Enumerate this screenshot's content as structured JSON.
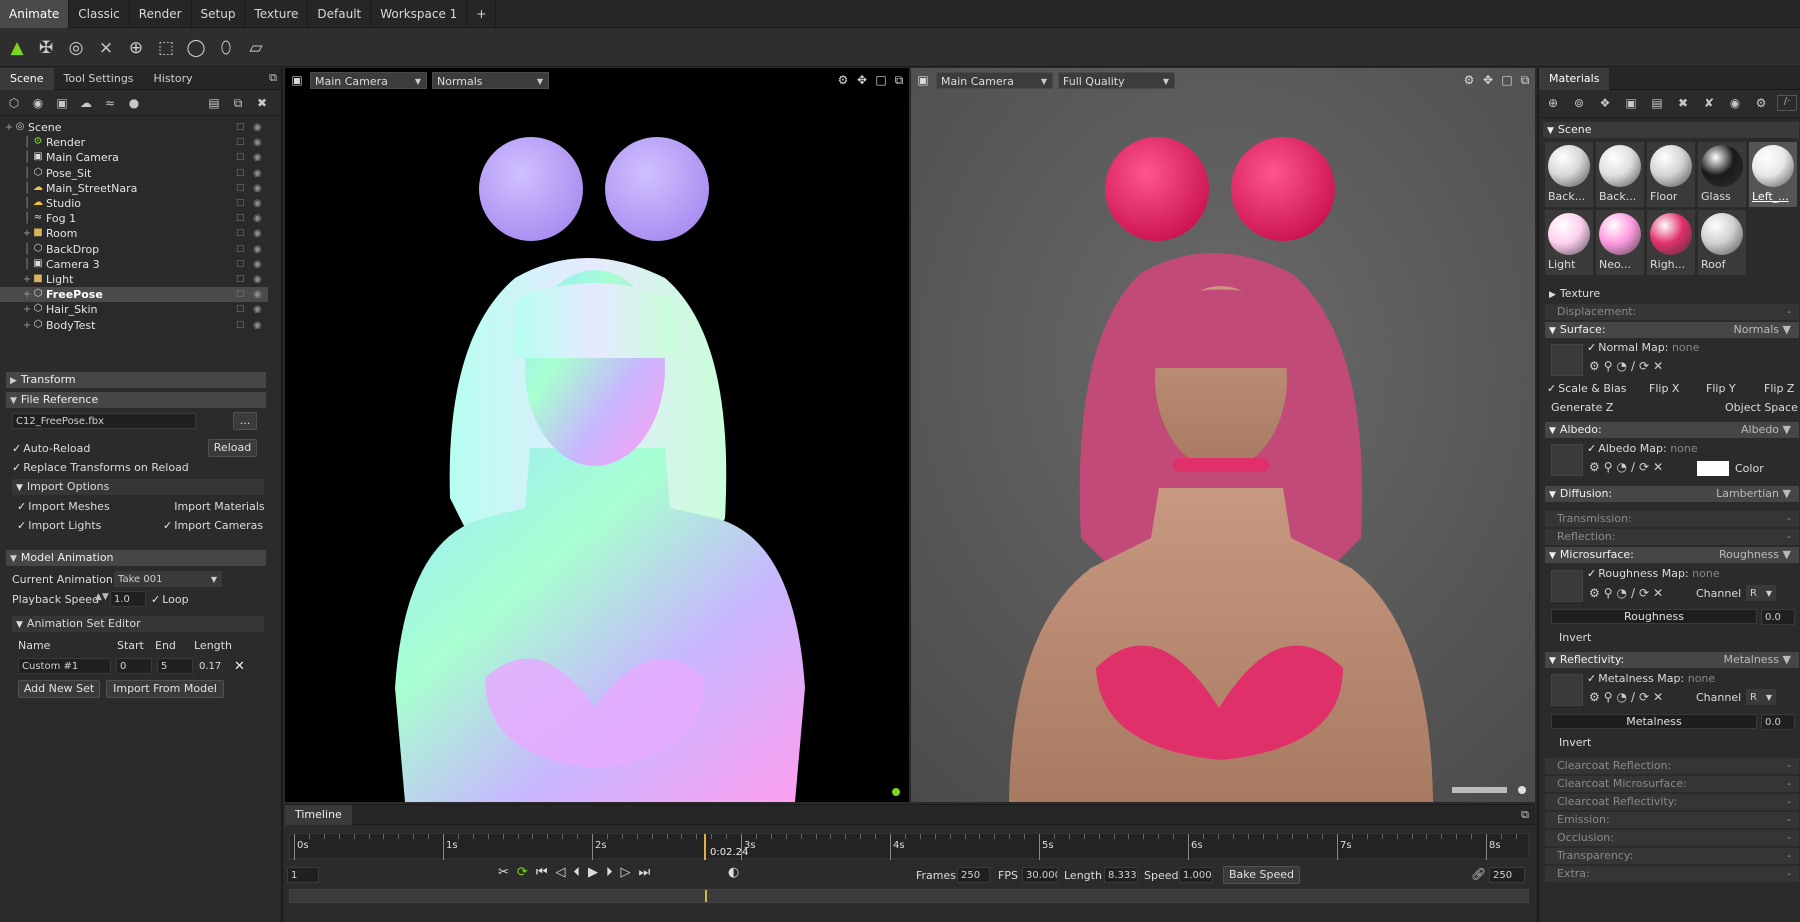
{
  "workspace_tabs": [
    "Animate",
    "Classic",
    "Render",
    "Setup",
    "Texture",
    "Default",
    "Workspace 1",
    "+"
  ],
  "left_tabs": [
    "Scene",
    "Tool Settings",
    "History"
  ],
  "scene_tree": [
    {
      "label": "Scene",
      "icon": "scene-icon"
    },
    {
      "label": "Render",
      "icon": "render-icon"
    },
    {
      "label": "Main Camera",
      "icon": "camera-icon"
    },
    {
      "label": "Pose_Sit",
      "icon": "object-icon"
    },
    {
      "label": "Main_StreetNara",
      "icon": "sky-icon"
    },
    {
      "label": "Studio",
      "icon": "sky-icon"
    },
    {
      "label": "Fog 1",
      "icon": "fog-icon"
    },
    {
      "label": "Room",
      "icon": "folder-icon"
    },
    {
      "label": "BackDrop",
      "icon": "object-icon"
    },
    {
      "label": "Camera 3",
      "icon": "camera-icon"
    },
    {
      "label": "Light",
      "icon": "folder-icon"
    },
    {
      "label": "FreePose",
      "icon": "object-icon"
    },
    {
      "label": "Hair_Skin",
      "icon": "object-icon"
    },
    {
      "label": "BodyTest",
      "icon": "object-icon"
    }
  ],
  "transform_label": "Transform",
  "file_reference": {
    "title": "File Reference",
    "file": "C12_FreePose.fbx",
    "browse": "...",
    "auto_reload": "Auto-Reload",
    "reload": "Reload",
    "replace_transforms": "Replace Transforms on Reload",
    "import_options": "Import Options",
    "import_meshes": "Import Meshes",
    "import_materials": "Import Materials",
    "import_lights": "Import Lights",
    "import_cameras": "Import Cameras"
  },
  "model_animation": {
    "title": "Model Animation",
    "current_label": "Current Animation:",
    "current_value": "Take 001",
    "playback_label": "Playback Speed",
    "playback_value": "1.0",
    "loop": "Loop",
    "set_editor": "Animation Set Editor",
    "col_name": "Name",
    "col_start": "Start",
    "col_end": "End",
    "col_length": "Length",
    "row_name": "Custom #1",
    "row_start": "0",
    "row_end": "5",
    "row_length": "0.17",
    "add_set": "Add New Set",
    "import_from_model": "Import From Model"
  },
  "viewport_left": {
    "camera": "Main Camera",
    "mode": "Normals"
  },
  "viewport_right": {
    "camera": "Main Camera",
    "mode": "Full Quality"
  },
  "timeline": {
    "title": "Timeline",
    "ticks": [
      "0s",
      "1s",
      "2s",
      "3s",
      "4s",
      "5s",
      "6s",
      "7s",
      "8s"
    ],
    "current_time": "0:02.24",
    "current_frame": "1",
    "frames_label": "Frames",
    "frames_value": "250",
    "fps_label": "FPS",
    "fps_value": "30.000",
    "length_label": "Length",
    "length_value": "8.333",
    "speed_label": "Speed",
    "speed_value": "1.000",
    "bake_speed": "Bake Speed",
    "end_frame": "250"
  },
  "materials": {
    "title": "Materials",
    "scene_label": "Scene",
    "items": [
      {
        "name": "Back...",
        "color": "#d8d8d8"
      },
      {
        "name": "Back...",
        "color": "#e0e0e0"
      },
      {
        "name": "Floor",
        "color": "#d4d4d4"
      },
      {
        "name": "Glass",
        "color": "#1a1a1a"
      },
      {
        "name": "Left_...",
        "color": "#e8e8e8"
      },
      {
        "name": "Light",
        "color": "#ffd0f0"
      },
      {
        "name": "Neo...",
        "color": "#ff9ae0"
      },
      {
        "name": "Righ...",
        "color": "#e0306a"
      },
      {
        "name": "Roof",
        "color": "#d0d0d0"
      }
    ],
    "texture": "Texture",
    "displacement": "Displacement:",
    "surface": "Surface:",
    "surface_value": "Normals",
    "normal_map": "Normal Map:",
    "none": "none",
    "scale_bias": "Scale & Bias",
    "flip_x": "Flip X",
    "flip_y": "Flip Y",
    "flip_z": "Flip Z",
    "generate_z": "Generate Z",
    "object_space": "Object Space",
    "albedo": "Albedo:",
    "albedo_value": "Albedo",
    "albedo_map": "Albedo Map:",
    "color": "Color",
    "diffusion": "Diffusion:",
    "diffusion_value": "Lambertian",
    "transmission": "Transmission:",
    "reflection": "Reflection:",
    "microsurface": "Microsurface:",
    "microsurface_value": "Roughness",
    "roughness_map": "Roughness Map:",
    "channel": "Channel",
    "channel_value": "R",
    "roughness": "Roughness",
    "roughness_value": "0.0",
    "invert": "Invert",
    "reflectivity": "Reflectivity:",
    "reflectivity_value": "Metalness",
    "metalness_map": "Metalness Map:",
    "metalness": "Metalness",
    "metalness_value": "0.0",
    "clearcoat_reflection": "Clearcoat Reflection:",
    "clearcoat_microsurface": "Clearcoat Microsurface:",
    "clearcoat_reflectivity": "Clearcoat Reflectivity:",
    "emission": "Emission:",
    "occlusion": "Occlusion:",
    "transparency": "Transparency:",
    "extra": "Extra:",
    "dash": "-"
  }
}
